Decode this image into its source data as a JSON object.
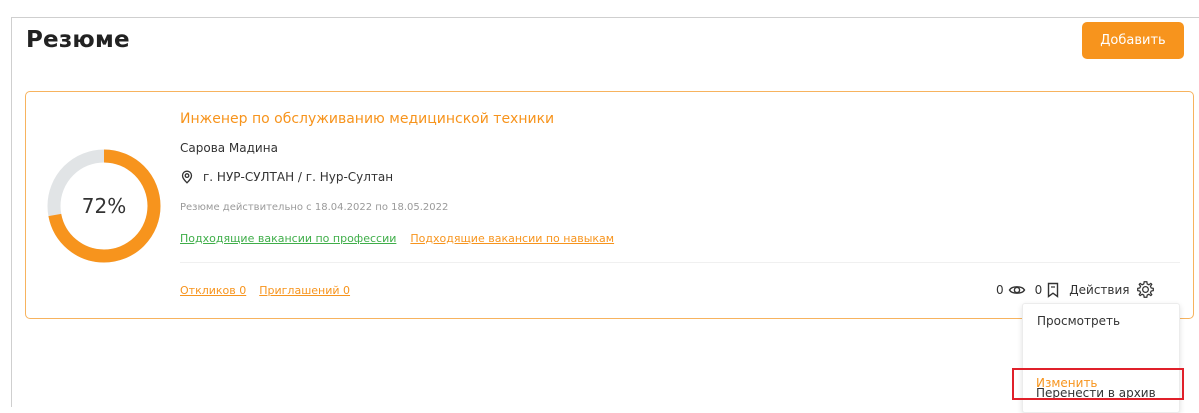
{
  "header": {
    "title": "Резюме",
    "add_label": "Добавить"
  },
  "resume": {
    "progress_label": "72%",
    "progress_value": 0.72,
    "job_title": "Инженер по обслуживанию медицинской техники",
    "person_name": "Сарова Мадина",
    "location": "г. НУР-СУЛТАН / г. Нур-Султан",
    "validity": "Резюме действительно с 18.04.2022 по 18.05.2022",
    "link_profession": "Подходящие вакансии по профессии",
    "link_skills": "Подходящие вакансии по навыкам",
    "responses": "Откликов 0",
    "invitations": "Приглашений 0",
    "views_count": "0",
    "saved_count": "0",
    "actions_label": "Действия"
  },
  "actions_menu": {
    "items": [
      "Просмотреть",
      "Изменить",
      "Перенести в архив"
    ]
  },
  "colors": {
    "accent": "#f7941d",
    "green_link": "#3fae49",
    "highlight": "#e0202a",
    "ring_track": "#e1e4e6"
  },
  "icons": {
    "location": "location-pin-icon",
    "views": "eye-icon",
    "saved": "bookmark-icon",
    "actions": "gear-icon"
  }
}
